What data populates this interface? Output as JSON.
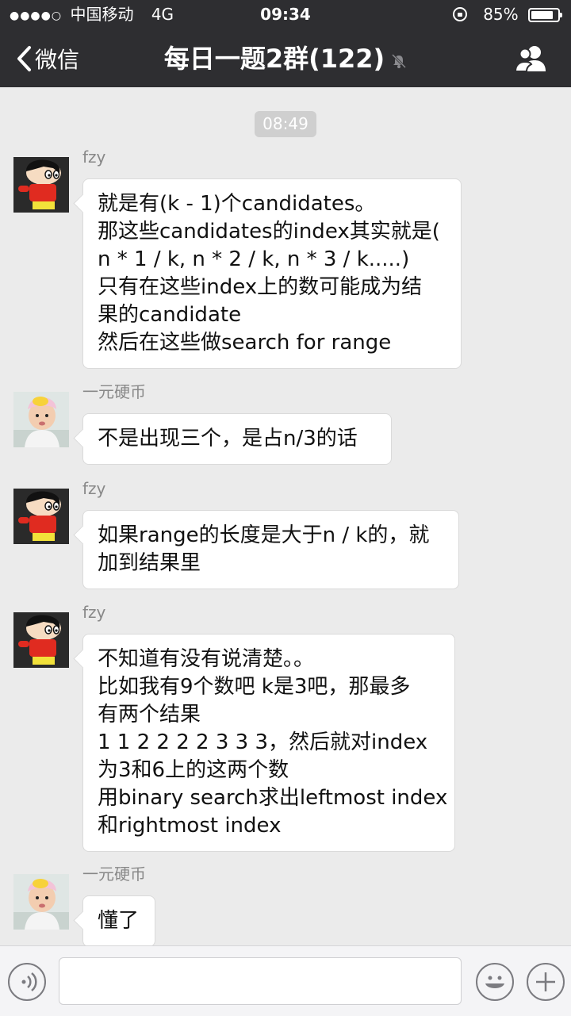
{
  "status_bar": {
    "carrier": "中国移动",
    "network": "4G",
    "time": "09:34",
    "battery": "85%",
    "battery_level": 0.85
  },
  "nav": {
    "back_label": "微信",
    "title": "每日一题2群(122)"
  },
  "chat": {
    "timestamp": "08:49",
    "messages": [
      {
        "sender": "fzy",
        "lines": [
          "就是有(k - 1)个candidates。",
          "那这些candidates的index其实就是(",
          "n * 1 / k, n * 2 / k, n * 3 / k.....)",
          "只有在这些index上的数可能成为结",
          "果的candidate",
          "然后在这些做search for range"
        ]
      },
      {
        "sender": "一元硬币",
        "lines": [
          "不是出现三个，是占n/3的话"
        ]
      },
      {
        "sender": "fzy",
        "lines": [
          "如果range的长度是大于n / k的，就",
          "加到结果里"
        ]
      },
      {
        "sender": "fzy",
        "lines": [
          "不知道有没有说清楚。。",
          "比如我有9个数吧 k是3吧，那最多",
          "有两个结果",
          "1 1 2 2 2 2 3 3 3，然后就对index",
          "为3和6上的这两个数",
          "用binary search求出leftmost index",
          "和rightmost index"
        ]
      },
      {
        "sender": "一元硬币",
        "lines": [
          "懂了"
        ]
      }
    ]
  },
  "input_bar": {
    "voice_icon": "voice-icon",
    "emoji_icon": "emoji-icon",
    "plus_icon": "plus-icon"
  },
  "colors": {
    "nav_bg": "#2e2e31",
    "chat_bg": "#ebebeb",
    "bubble_bg": "#ffffff"
  }
}
